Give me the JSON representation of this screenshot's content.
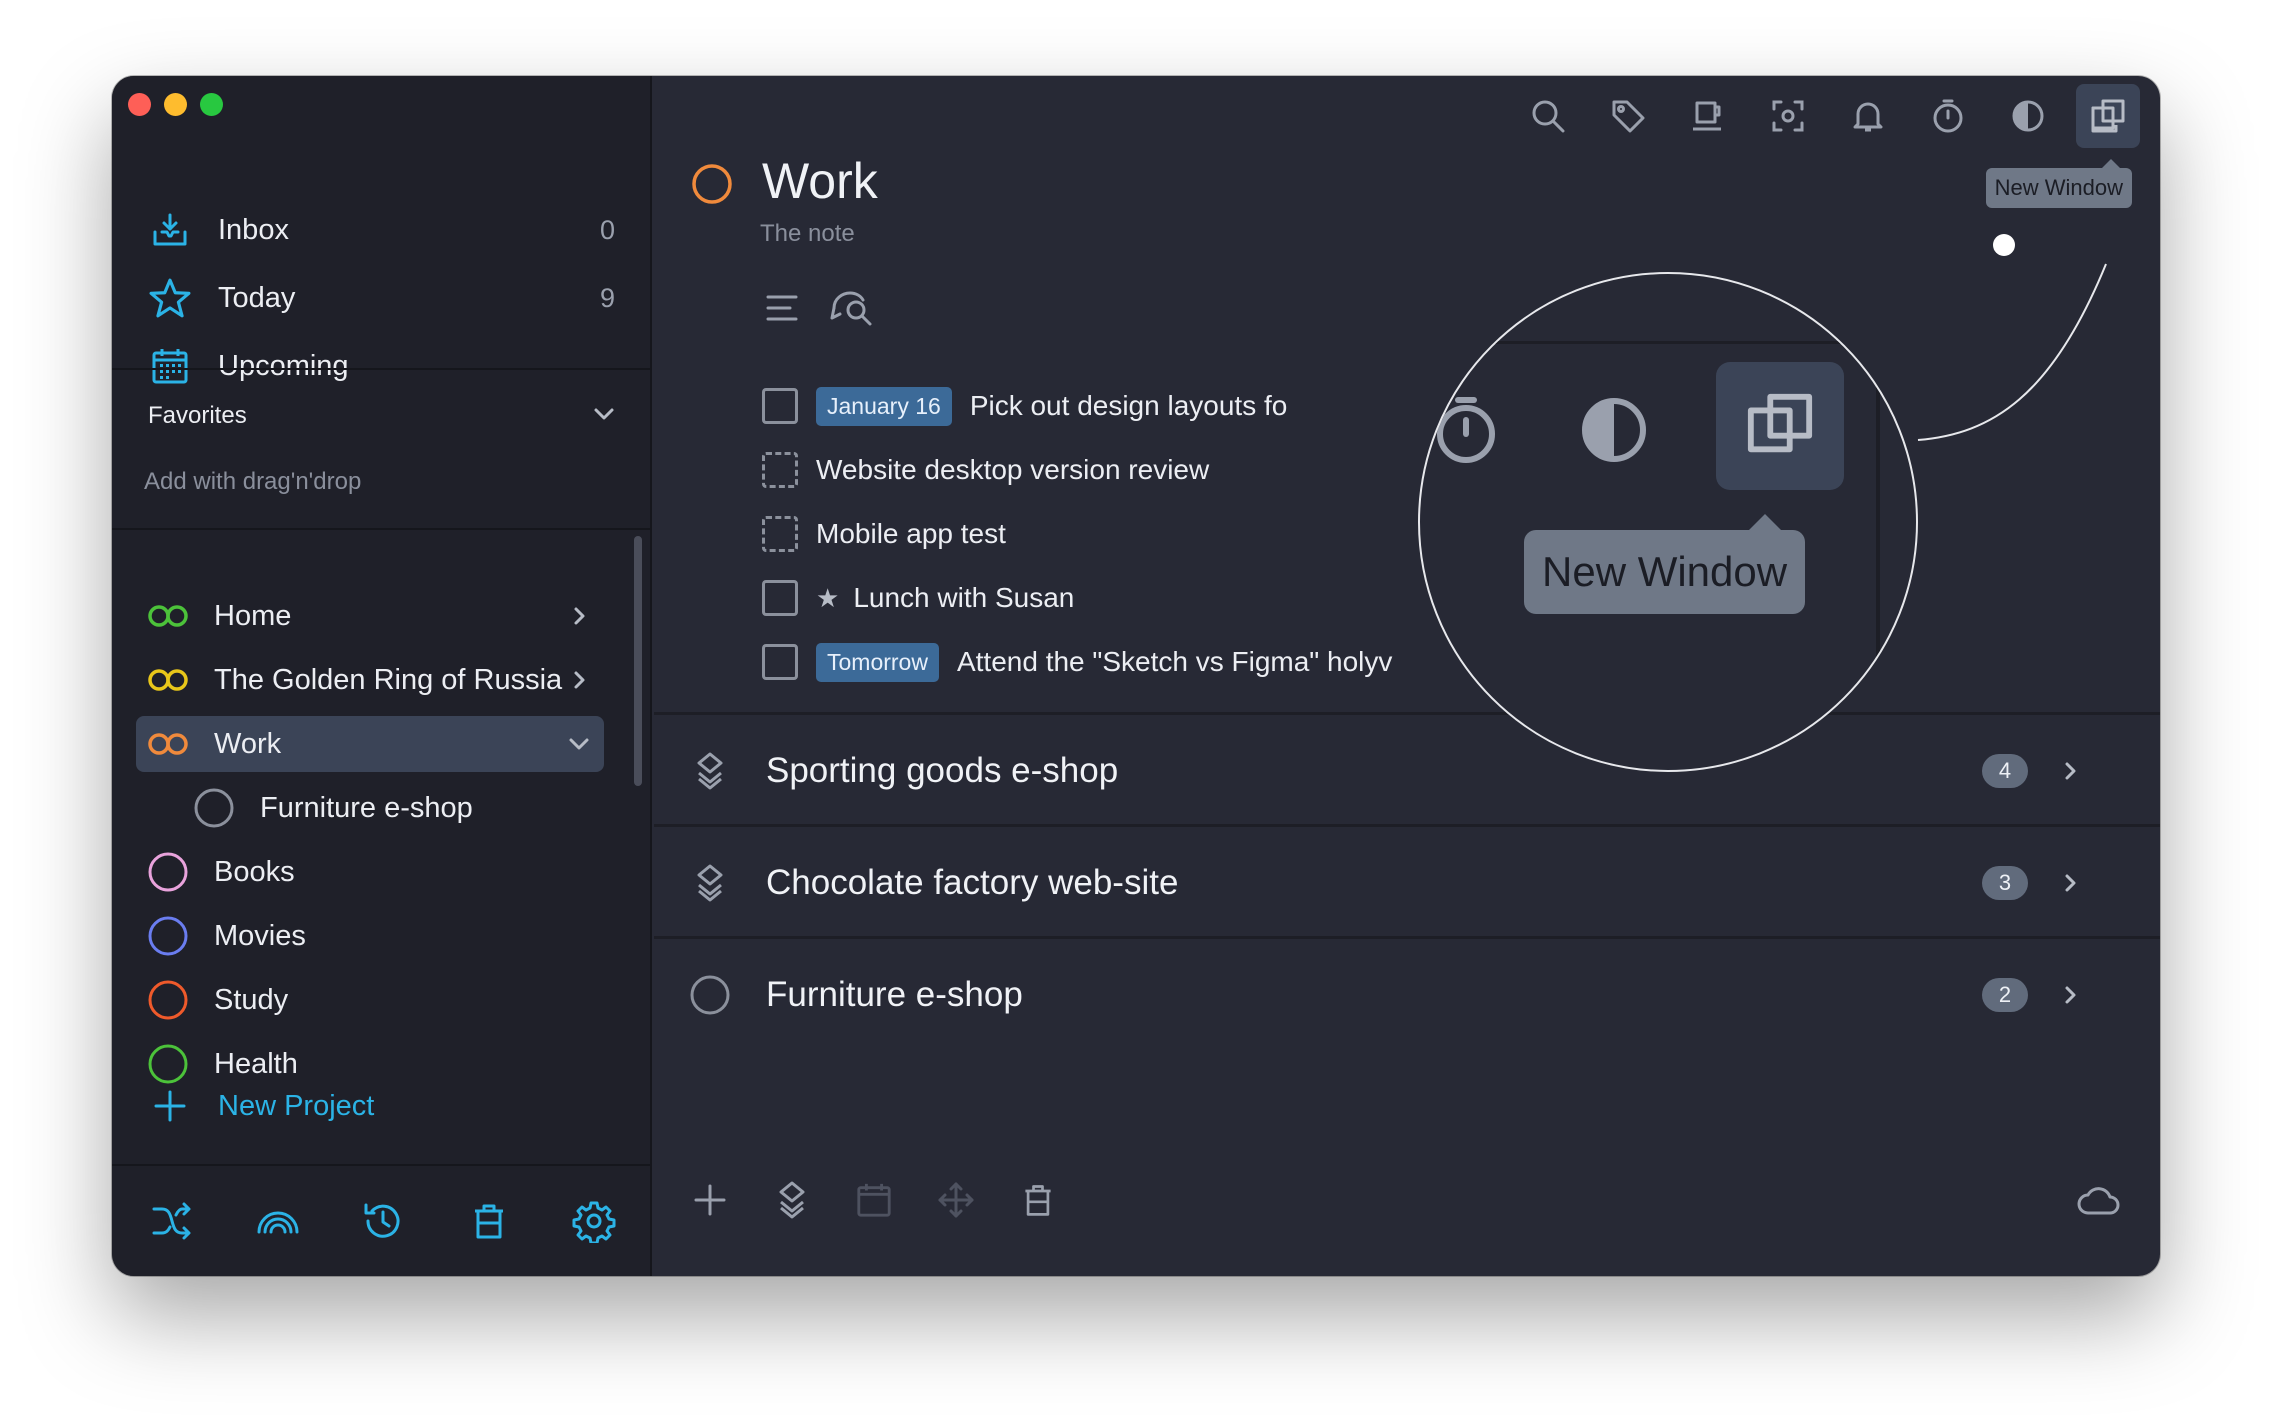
{
  "sidebar": {
    "nav": [
      {
        "label": "Inbox",
        "count": "0",
        "icon": "inbox-icon"
      },
      {
        "label": "Today",
        "count": "9",
        "icon": "star-icon"
      },
      {
        "label": "Upcoming",
        "count": "",
        "icon": "calendar-icon"
      }
    ],
    "favorites": {
      "title": "Favorites",
      "hint": "Add with drag'n'drop"
    },
    "projects": [
      {
        "label": "Home",
        "icon": "infinity-icon",
        "color": "#4cc23a"
      },
      {
        "label": "The Golden Ring of Russia",
        "icon": "infinity-icon",
        "color": "#e8c61a"
      },
      {
        "label": "Work",
        "icon": "infinity-icon",
        "color": "#f08a3c"
      },
      {
        "label": "Furniture e-shop",
        "icon": "circle-icon",
        "color": "#8b909c"
      },
      {
        "label": "Books",
        "icon": "circle-icon",
        "color": "#e9a3dc"
      },
      {
        "label": "Movies",
        "icon": "circle-icon",
        "color": "#6a7df0"
      },
      {
        "label": "Study",
        "icon": "circle-icon",
        "color": "#ef5a2b"
      },
      {
        "label": "Health",
        "icon": "circle-icon",
        "color": "#4cc23a"
      }
    ],
    "new_project": "New Project"
  },
  "main": {
    "title": "Work",
    "note": "The note",
    "tooltip": "New Window",
    "tasks": [
      {
        "date": "January 16",
        "text": "Pick out design layouts fo",
        "type": "solid"
      },
      {
        "date": "",
        "text": "Website desktop version review",
        "type": "dashed"
      },
      {
        "date": "",
        "text": "Mobile app test",
        "type": "dashed"
      },
      {
        "date": "",
        "text": "Lunch with Susan",
        "type": "solid",
        "star": "★"
      },
      {
        "date": "Tomorrow",
        "text": "Attend the \"Sketch vs Figma\" holyv",
        "type": "solid"
      }
    ],
    "groups": [
      {
        "label": "Sporting goods e-shop",
        "count": "4",
        "icon": "layers-icon"
      },
      {
        "label": "Chocolate factory web-site",
        "count": "3",
        "icon": "layers-icon"
      },
      {
        "label": "Furniture e-shop",
        "count": "2",
        "icon": "circle-icon"
      }
    ]
  },
  "magnifier": {
    "tooltip": "New Window"
  },
  "colors": {
    "accent": "#2bb3e6",
    "window_bg": "#272935",
    "sidebar_bg": "#1f2029",
    "active_bg": "#3b4457",
    "chip_bg": "#3c6a98"
  }
}
